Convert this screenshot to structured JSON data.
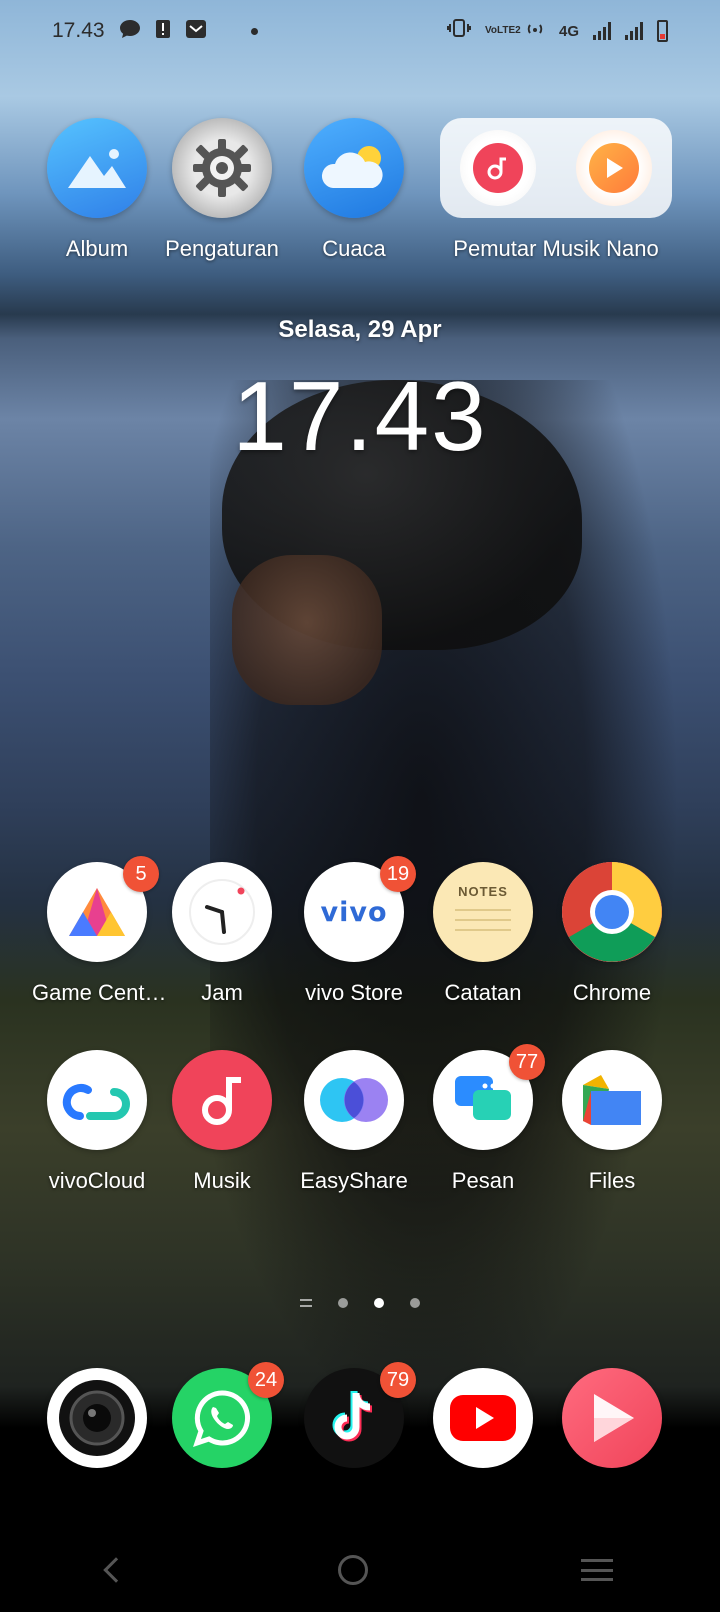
{
  "status_bar": {
    "time": "17.43",
    "network_label": "4G",
    "volte_label": "VoLTE2"
  },
  "widgets": {
    "music_widget_label": "Pemutar Musik Nano"
  },
  "top_apps": [
    {
      "label": "Album"
    },
    {
      "label": "Pengaturan"
    },
    {
      "label": "Cuaca"
    }
  ],
  "clock": {
    "date": "Selasa, 29 Apr",
    "time": "17.43"
  },
  "row1": [
    {
      "label": "Game Cent…",
      "badge": "5"
    },
    {
      "label": "Jam"
    },
    {
      "label": "vivo Store",
      "badge": "19"
    },
    {
      "label": "Catatan"
    },
    {
      "label": "Chrome"
    }
  ],
  "row2": [
    {
      "label": "vivoCloud"
    },
    {
      "label": "Musik"
    },
    {
      "label": "EasyShare"
    },
    {
      "label": "Pesan",
      "badge": "77"
    },
    {
      "label": "Files"
    }
  ],
  "dock": [
    {
      "name": "camera"
    },
    {
      "name": "whatsapp",
      "badge": "24"
    },
    {
      "name": "tiktok",
      "badge": "79"
    },
    {
      "name": "youtube"
    },
    {
      "name": "video-player"
    }
  ],
  "icons_text": {
    "notes_label": "NOTES",
    "vivo_label": "vivo"
  },
  "pager": {
    "page_count": 3,
    "active_index": 1
  },
  "colors": {
    "badge": "#f05236",
    "album": "#3a9bf0",
    "musik": "#f0445a",
    "whatsapp": "#25d366",
    "youtube": "#ff0000"
  }
}
